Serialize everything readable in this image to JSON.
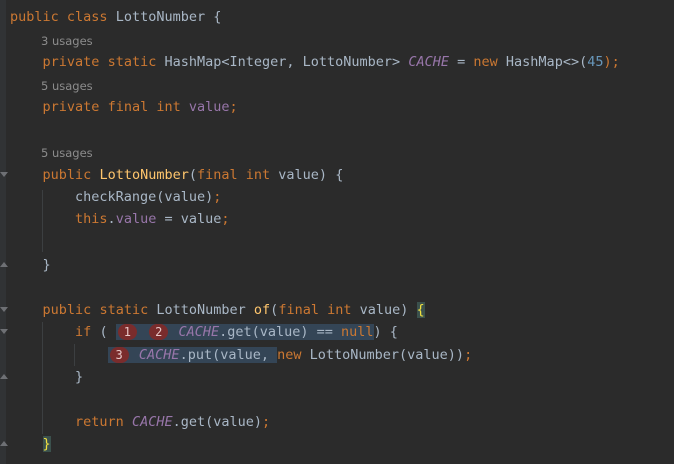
{
  "editor": {
    "class_decl": {
      "public": "public",
      "class": "class",
      "name": "LottoNumber",
      "brace": "{"
    },
    "usages_cache": "3 usages",
    "cache_line": {
      "private": "private",
      "static": "static",
      "type": "HashMap<Integer, LottoNumber>",
      "field": "CACHE",
      "eq": "=",
      "new": "new",
      "ctor": "HashMap<>",
      "open": "(",
      "arg": "45",
      "close": ");"
    },
    "usages_value": "5 usages",
    "value_line": {
      "private": "private",
      "final": "final",
      "int": "int",
      "field": "value",
      "semi": ";"
    },
    "usages_ctor": "5 usages",
    "ctor_line": {
      "public": "public",
      "name": "LottoNumber",
      "open": "(",
      "final": "final",
      "int": "int",
      "param": "value) {"
    },
    "check_line": {
      "call": "checkRange(value)",
      "semi": ";"
    },
    "this_line": {
      "this": "this",
      "dot": ".",
      "field": "value",
      "rest": " = value",
      "semi": ";"
    },
    "ctor_close": "}",
    "of_line": {
      "public": "public",
      "static": "static",
      "type": "LottoNumber",
      "name": "of",
      "open": "(",
      "final": "final",
      "int": "int",
      "param": "value)",
      "brace": "{"
    },
    "if_line": {
      "if": "if",
      "paren": "(",
      "badge1": "1",
      "badge2": "2",
      "field": "CACHE",
      "call": ".get(value) == ",
      "null": "null",
      "close": ") {"
    },
    "put_line": {
      "badge3": "3",
      "field": "CACHE",
      "call": ".put(value, ",
      "new": "new",
      "rest": " LottoNumber(value))",
      "semi": ";"
    },
    "if_close": "}",
    "return_line": {
      "return": "return",
      "field": "CACHE",
      "call": ".get(value)",
      "semi": ";"
    },
    "method_close": "}"
  }
}
